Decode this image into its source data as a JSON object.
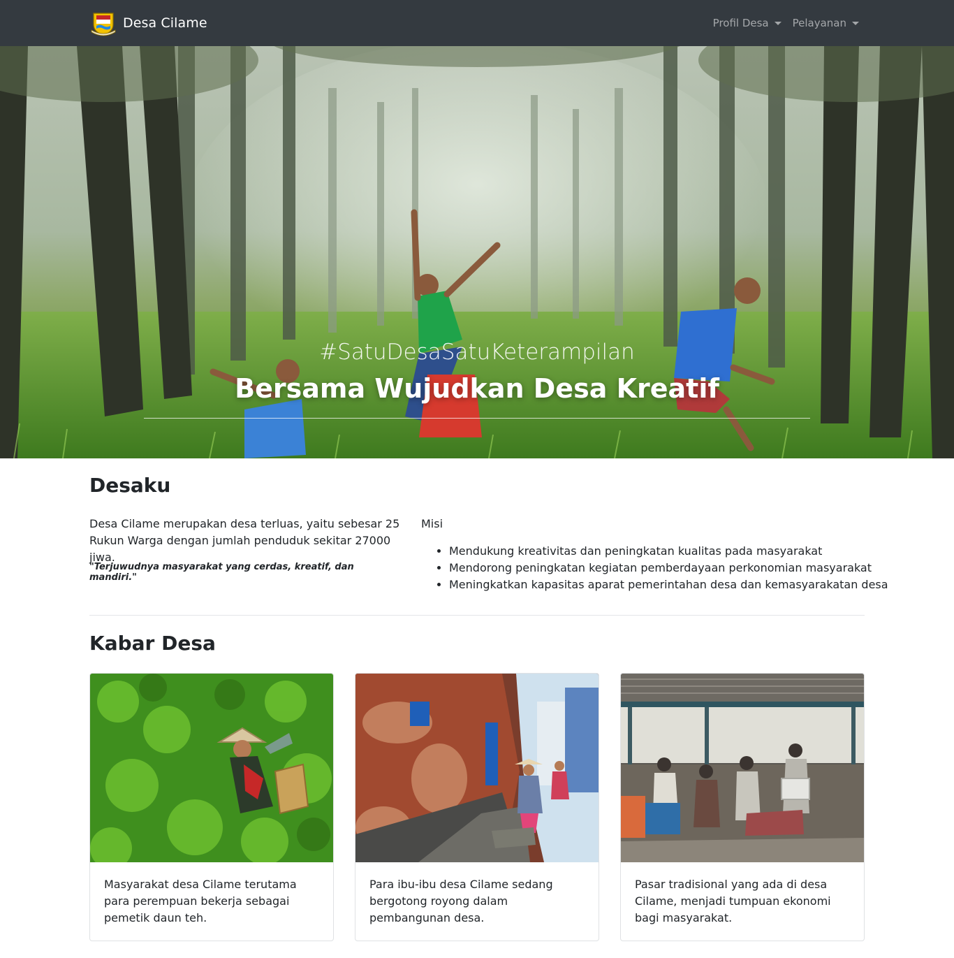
{
  "navbar": {
    "brand": "Desa Cilame",
    "items": [
      {
        "label": "Profil Desa"
      },
      {
        "label": "Pelayanan"
      }
    ]
  },
  "hero": {
    "subtitle": "#SatuDesaSatuKeterampilan",
    "title": "Bersama Wujudkan Desa Kreatif"
  },
  "about": {
    "heading": "Desaku",
    "description": "Desa Cilame merupakan desa terluas, yaitu sebesar 25 Rukun Warga dengan jumlah penduduk sekitar 27000 jiwa.",
    "vision": "\"Terjuwudnya masyarakat yang cerdas, kreatif, dan mandiri.\"",
    "mission_label": "Misi",
    "missions": [
      "Mendukung kreativitas dan peningkatan kualitas pada masyarakat",
      "Mendorong peningkatan kegiatan pemberdayaan perkonomian masyarakat",
      "Meningkatkan kapasitas aparat pemerintahan desa dan kemasyarakatan desa"
    ]
  },
  "news": {
    "heading": "Kabar Desa",
    "cards": [
      {
        "text": "Masyarakat desa Cilame terutama para perempuan bekerja sebagai pemetik daun teh."
      },
      {
        "text": "Para ibu-ibu desa Cilame sedang bergotong royong dalam pembangunan desa."
      },
      {
        "text": "Pasar tradisional yang ada di desa Cilame, menjadi tumpuan ekonomi bagi masyarakat."
      }
    ]
  },
  "colors": {
    "navbar_bg": "#343a40",
    "nav_text": "rgba(255,255,255,0.55)"
  }
}
